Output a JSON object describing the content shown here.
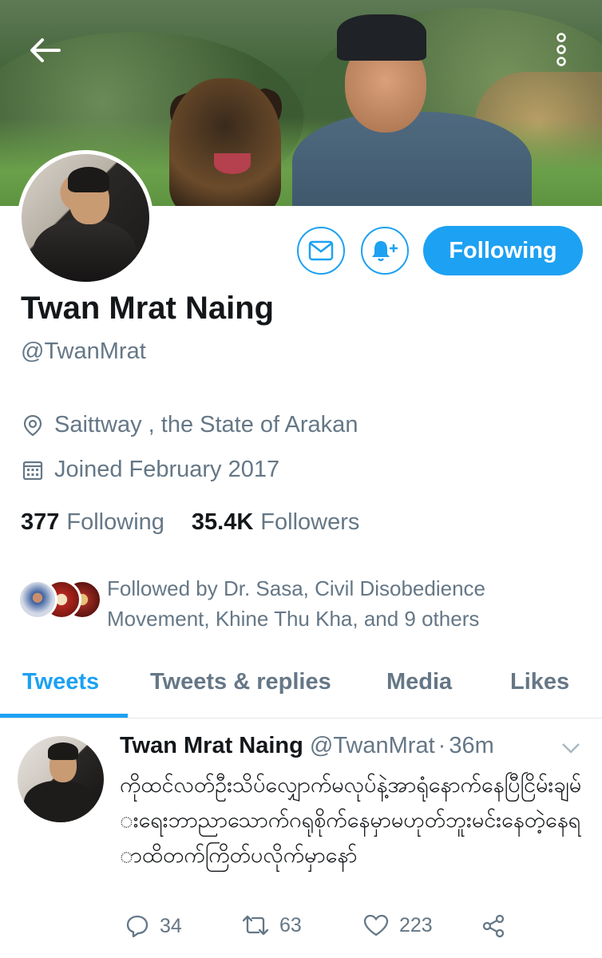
{
  "profile": {
    "name": "Twan Mrat Naing",
    "handle": "@TwanMrat",
    "location": "Saittway , the State of Arakan",
    "joined": "Joined February 2017",
    "following_count": "377",
    "following_label": "Following",
    "followers_count": "35.4K",
    "followers_label": "Followers",
    "followed_by": "Followed by Dr. Sasa, Civil Disobedience Movement, Khine Thu Kha, and 9 others"
  },
  "actions": {
    "following_button": "Following"
  },
  "tabs": [
    {
      "label": "Tweets",
      "active": true
    },
    {
      "label": "Tweets & replies",
      "active": false
    },
    {
      "label": "Media",
      "active": false
    },
    {
      "label": "Likes",
      "active": false
    }
  ],
  "tweet": {
    "name": "Twan Mrat Naing",
    "handle": "@TwanMrat",
    "separator": "·",
    "time": "36m",
    "text": "ကိုထင်လတ်ဦးသိပ်လျှောက်မလုပ်နဲ့အာရုံနောက်နေပြီငြိမ်းချမ်းရေးဘာညာသောက်ဂရုစိုက်နေမှာမဟုတ်ဘူးမင်းနေတဲ့နေရာထိတက်ကြိတ်ပလိုက်မှာနော်",
    "reply_count": "34",
    "retweet_count": "63",
    "like_count": "223"
  },
  "colors": {
    "accent": "#1da1f2",
    "secondary_text": "#657786",
    "primary_text": "#14171a"
  },
  "icons": [
    "back-arrow-icon",
    "more-vertical-icon",
    "envelope-icon",
    "bell-plus-icon",
    "location-pin-icon",
    "calendar-icon",
    "reply-icon",
    "retweet-icon",
    "heart-icon",
    "share-icon",
    "chevron-down-icon"
  ]
}
